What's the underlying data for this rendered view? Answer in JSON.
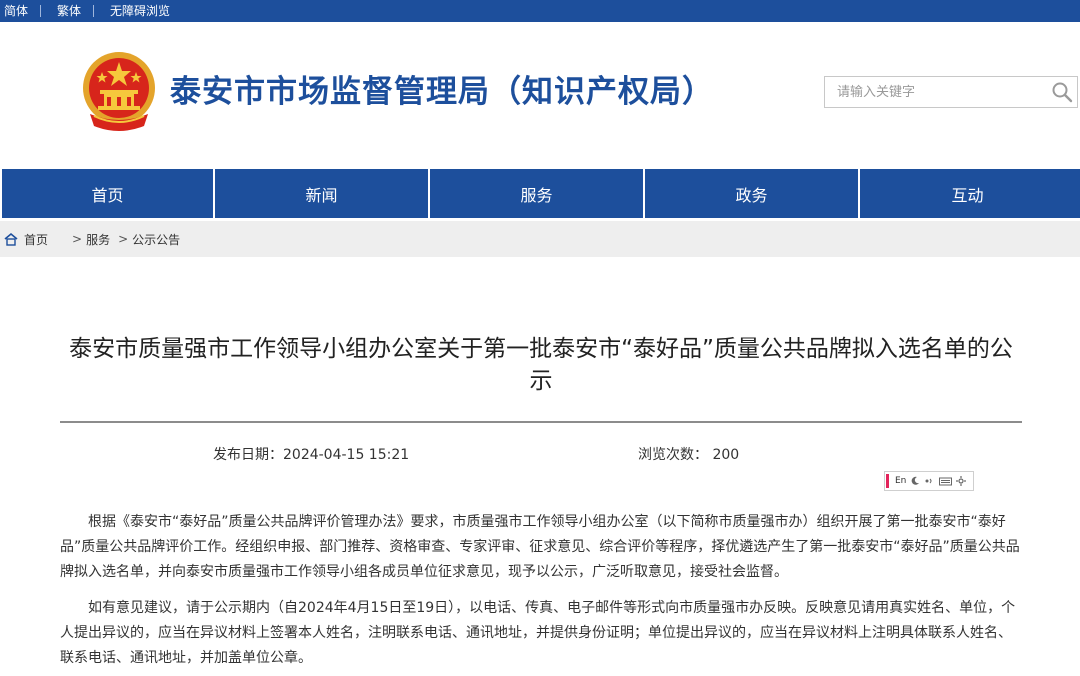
{
  "topbar": {
    "links": [
      "简体",
      "繁体",
      "无障碍浏览"
    ]
  },
  "header": {
    "title": "泰安市市场监督管理局（知识产权局）",
    "search_placeholder": "请输入关键字",
    "emblem_icon": "national-emblem-icon",
    "search_icon": "search-icon"
  },
  "nav": {
    "items": [
      "首页",
      "新闻",
      "服务",
      "政务",
      "互动"
    ]
  },
  "breadcrumb": {
    "home": "首页",
    "sep": ">",
    "level1": "服务",
    "level2": "公示公告"
  },
  "article": {
    "title": "泰安市质量强市工作领导小组办公室关于第一批泰安市“泰好品”质量公共品牌拟入选名单的公示",
    "date": "发布日期：2024-04-15 15:21",
    "views": "浏览次数： 200",
    "paragraphs": [
      "根据《泰安市“泰好品”质量公共品牌评价管理办法》要求，市质量强市工作领导小组办公室（以下简称市质量强市办）组织开展了第一批泰安市“泰好品”质量公共品牌评价工作。经组织申报、部门推荐、资格审查、专家评审、征求意见、综合评价等程序，择优遴选产生了第一批泰安市“泰好品”质量公共品牌拟入选名单，并向泰安市质量强市工作领导小组各成员单位征求意见，现予以公示，广泛听取意见，接受社会监督。",
      "如有意见建议，请于公示期内（自2024年4月15日至19日），以电话、传真、电子邮件等形式向市质量强市办反映。反映意见请用真实姓名、单位，个人提出异议的，应当在异议材料上签署本人姓名，注明联系电话、通讯地址，并提供身份证明；单位提出异议的，应当在异议材料上注明具体联系人姓名、联系电话、通讯地址，并加盖单位公章。"
    ]
  },
  "a11y_toolbar": {
    "lang": "En"
  },
  "colors": {
    "brand_blue": "#1d4f9c",
    "crumb_bg": "#eeeeee",
    "accent_red": "#e3245b"
  }
}
